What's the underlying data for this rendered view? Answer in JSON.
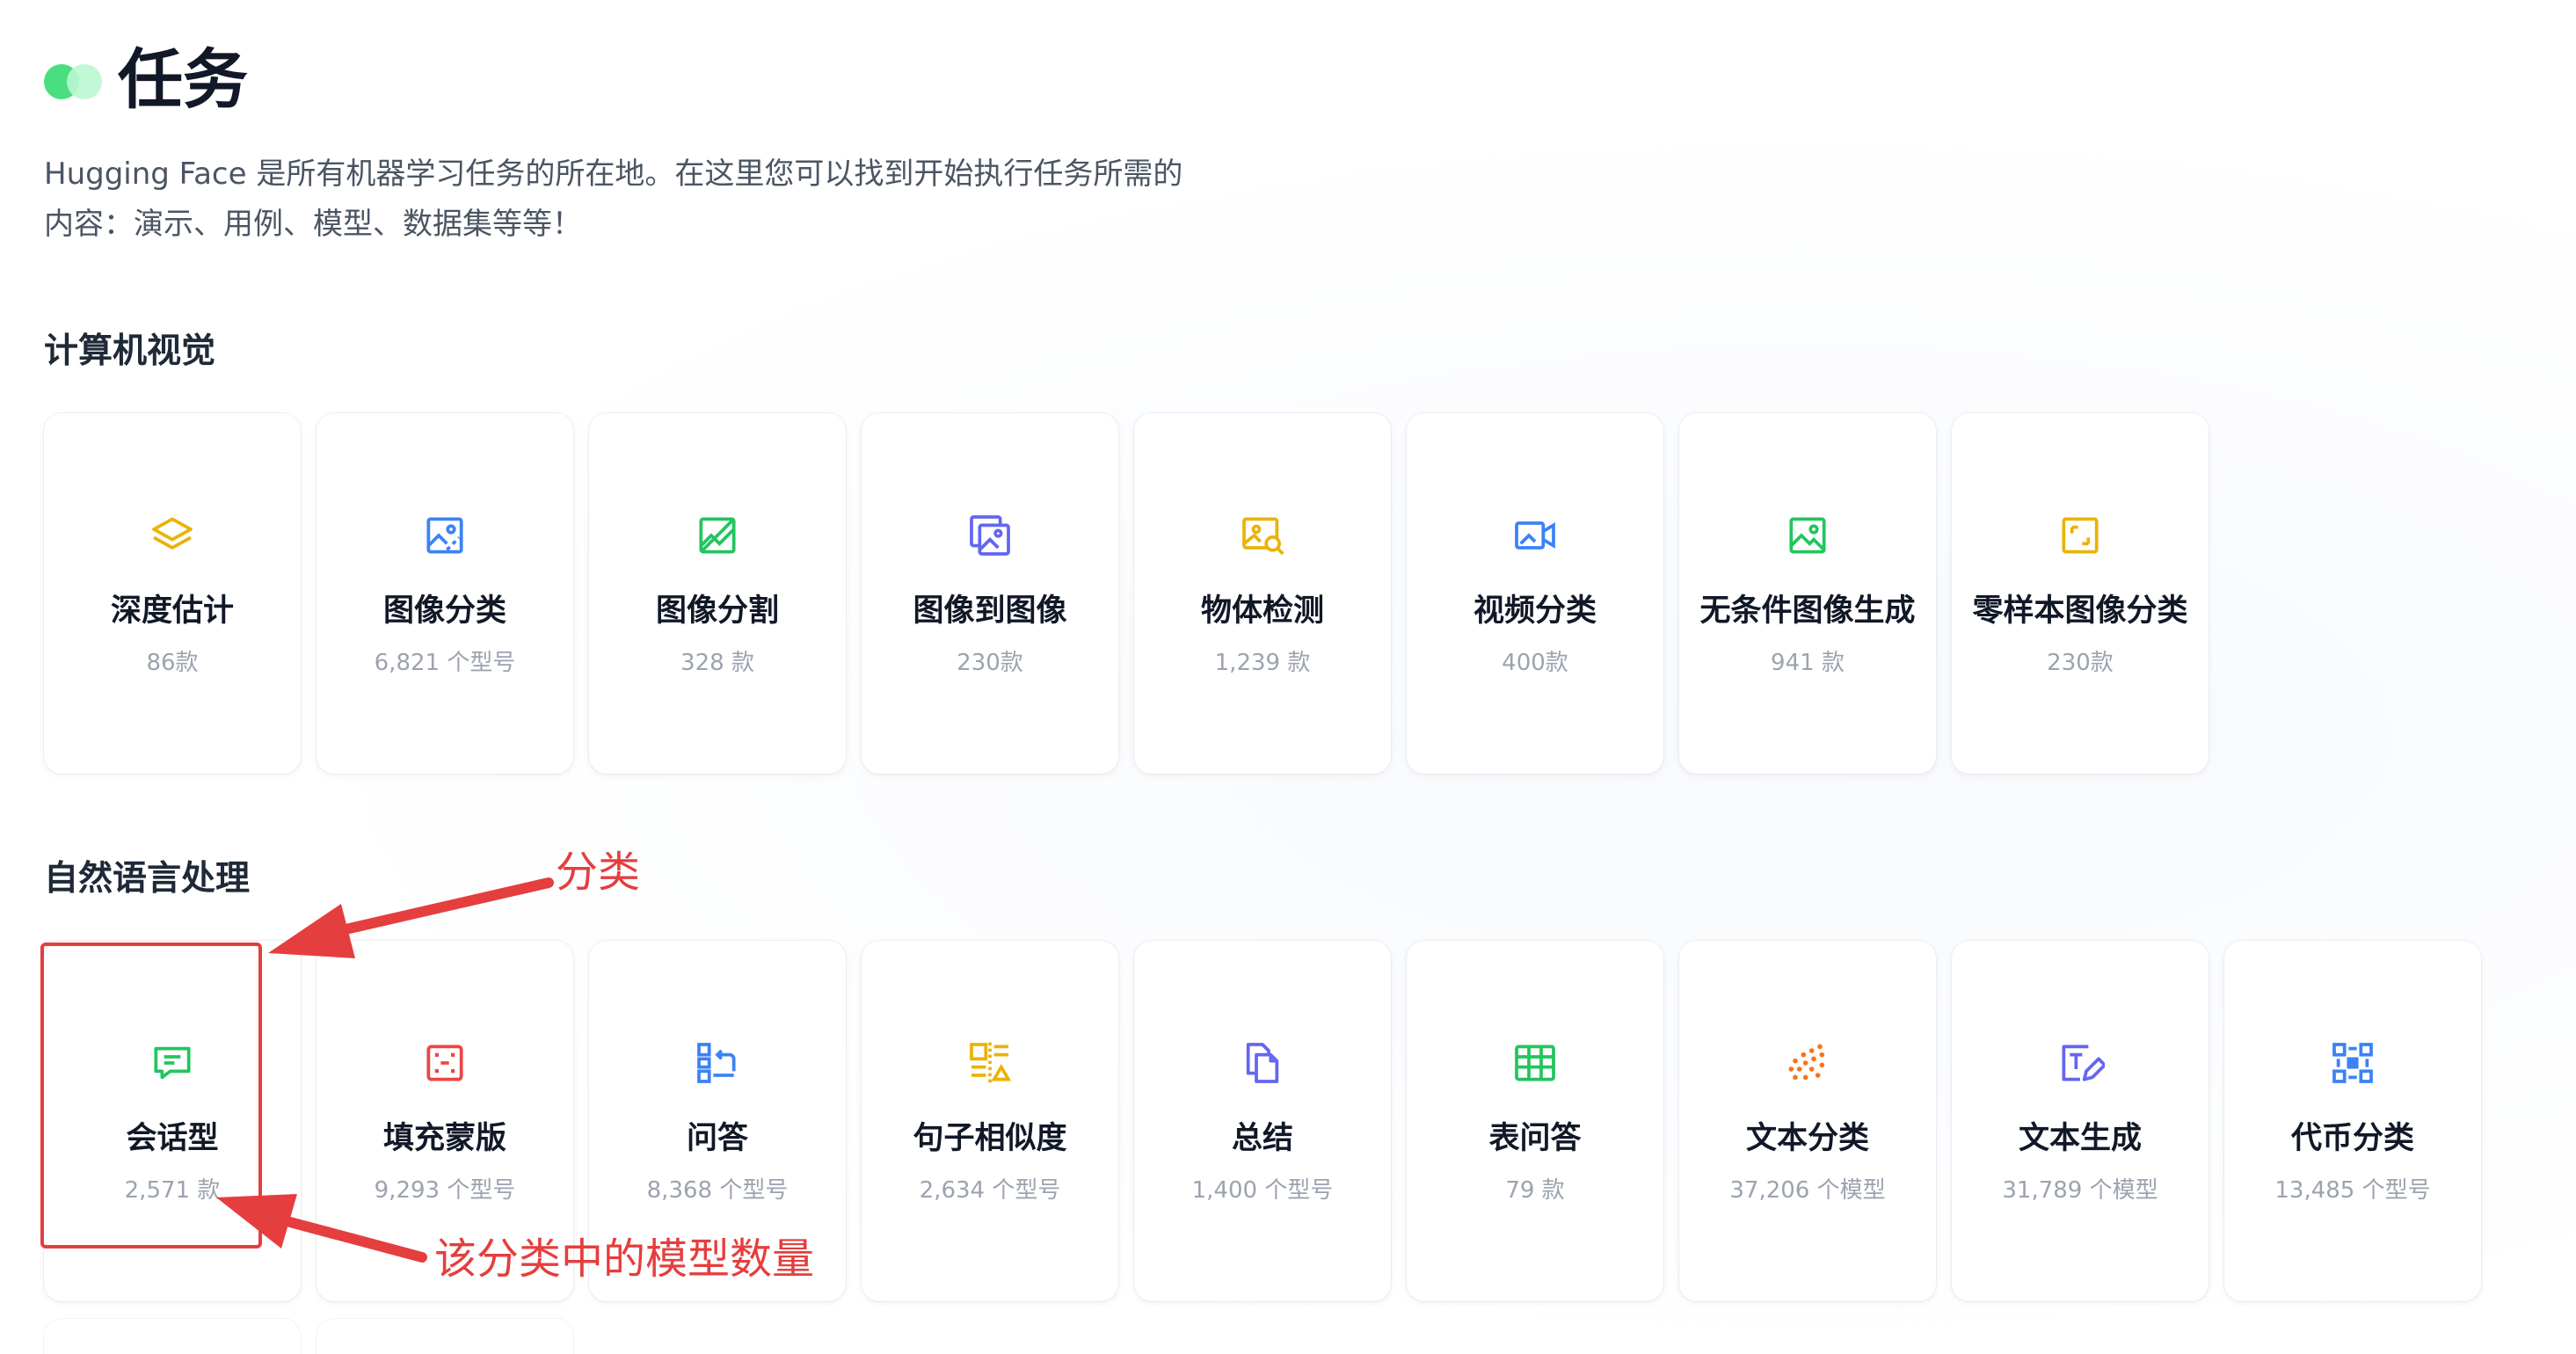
{
  "header": {
    "title": "任务",
    "intro_line1": "Hugging Face 是所有机器学习任务的所在地。在这里您可以找到开始执行任务所需的",
    "intro_line2": "内容：演示、用例、模型、数据集等等！"
  },
  "sections": [
    {
      "title": "计算机视觉",
      "cards": [
        {
          "name": "深度估计",
          "count": "86款",
          "icon": "layers-icon",
          "color": "#eab308"
        },
        {
          "name": "图像分类",
          "count": "6,821 个型号",
          "icon": "image-classification-icon",
          "color": "#3b82f6"
        },
        {
          "name": "图像分割",
          "count": "328 款",
          "icon": "image-segmentation-icon",
          "color": "#22c55e"
        },
        {
          "name": "图像到图像",
          "count": "230款",
          "icon": "image-to-image-icon",
          "color": "#6366f1"
        },
        {
          "name": "物体检测",
          "count": "1,239 款",
          "icon": "object-detection-icon",
          "color": "#eab308"
        },
        {
          "name": "视频分类",
          "count": "400款",
          "icon": "video-classification-icon",
          "color": "#3b82f6"
        },
        {
          "name": "无条件图像生成",
          "count": "941 款",
          "icon": "image-generation-icon",
          "color": "#22c55e"
        },
        {
          "name": "零样本图像分类",
          "count": "230款",
          "icon": "zero-shot-icon",
          "color": "#eab308"
        }
      ]
    },
    {
      "title": "自然语言处理",
      "cards": [
        {
          "name": "会话型",
          "count": "2,571 款",
          "icon": "chat-bubble-icon",
          "color": "#22c55e"
        },
        {
          "name": "填充蒙版",
          "count": "9,293 个型号",
          "icon": "fill-mask-icon",
          "color": "#ef4444"
        },
        {
          "name": "问答",
          "count": "8,368 个型号",
          "icon": "question-answering-icon",
          "color": "#3b82f6"
        },
        {
          "name": "句子相似度",
          "count": "2,634 个型号",
          "icon": "sentence-similarity-icon",
          "color": "#eab308"
        },
        {
          "name": "总结",
          "count": "1,400 个型号",
          "icon": "documents-icon",
          "color": "#6366f1"
        },
        {
          "name": "表问答",
          "count": "79 款",
          "icon": "table-icon",
          "color": "#22c55e"
        },
        {
          "name": "文本分类",
          "count": "37,206 个模型",
          "icon": "dots-icon",
          "color": "#f97316"
        },
        {
          "name": "文本生成",
          "count": "31,789 个模型",
          "icon": "text-generation-icon",
          "color": "#6366f1"
        },
        {
          "name": "代币分类",
          "count": "13,485 个型号",
          "icon": "token-classification-icon",
          "color": "#3b82f6"
        }
      ]
    }
  ],
  "annotations": {
    "category_label": "分类",
    "count_label": "该分类中的模型数量",
    "color": "#e53e3e"
  }
}
